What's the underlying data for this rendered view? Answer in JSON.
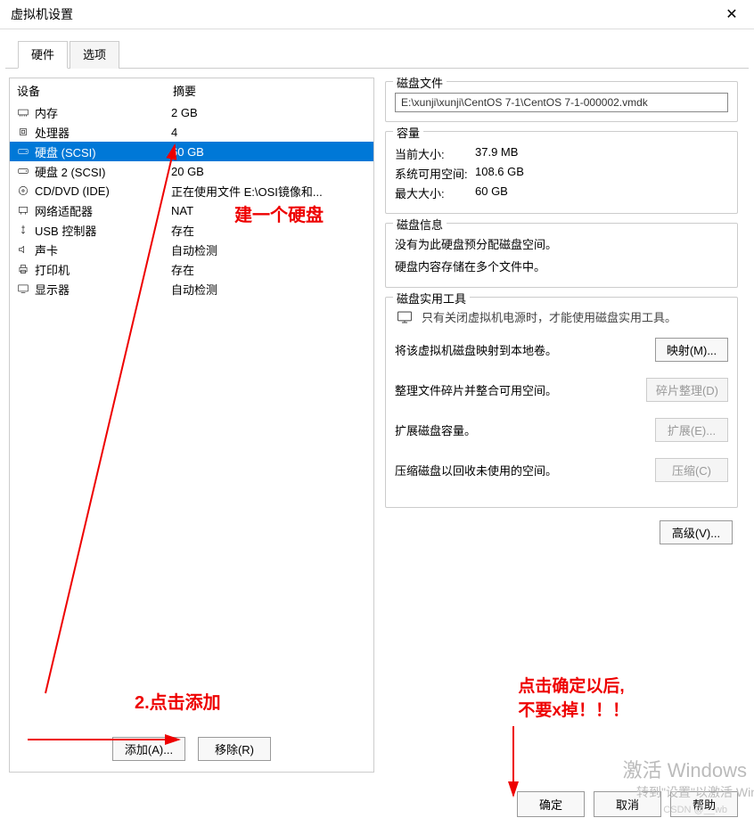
{
  "window": {
    "title": "虚拟机设置"
  },
  "tabs": {
    "hardware": "硬件",
    "options": "选项"
  },
  "dev_header": {
    "col1": "设备",
    "col2": "摘要"
  },
  "devices": [
    {
      "icon": "memory-icon",
      "name": "内存",
      "summary": "2 GB"
    },
    {
      "icon": "cpu-icon",
      "name": "处理器",
      "summary": "4"
    },
    {
      "icon": "disk-icon",
      "name": "硬盘 (SCSI)",
      "summary": "60 GB"
    },
    {
      "icon": "disk-icon",
      "name": "硬盘 2 (SCSI)",
      "summary": "20 GB"
    },
    {
      "icon": "cd-icon",
      "name": "CD/DVD (IDE)",
      "summary": "正在使用文件 E:\\OSI镜像和..."
    },
    {
      "icon": "network-icon",
      "name": "网络适配器",
      "summary": "NAT"
    },
    {
      "icon": "usb-icon",
      "name": "USB 控制器",
      "summary": "存在"
    },
    {
      "icon": "sound-icon",
      "name": "声卡",
      "summary": "自动检测"
    },
    {
      "icon": "printer-icon",
      "name": "打印机",
      "summary": "存在"
    },
    {
      "icon": "display-icon",
      "name": "显示器",
      "summary": "自动检测"
    }
  ],
  "selected_index": 2,
  "buttons": {
    "add": "添加(A)...",
    "remove": "移除(R)",
    "ok": "确定",
    "cancel": "取消",
    "help": "帮助",
    "advanced": "高级(V)..."
  },
  "groups": {
    "diskfile": {
      "title": "磁盘文件",
      "path": "E:\\xunji\\xunji\\CentOS 7-1\\CentOS 7-1-000002.vmdk"
    },
    "capacity": {
      "title": "容量",
      "current_label": "当前大小:",
      "current_val": "37.9 MB",
      "avail_label": "系统可用空间:",
      "avail_val": "108.6 GB",
      "max_label": "最大大小:",
      "max_val": "60 GB"
    },
    "diskinfo": {
      "title": "磁盘信息",
      "line1": "没有为此硬盘预分配磁盘空间。",
      "line2": "硬盘内容存储在多个文件中。"
    },
    "utility": {
      "title": "磁盘实用工具",
      "hint": "只有关闭虚拟机电源时，才能使用磁盘实用工具。",
      "rows": [
        {
          "text": "将该虚拟机磁盘映射到本地卷。",
          "btn": "映射(M)...",
          "disabled": false
        },
        {
          "text": "整理文件碎片并整合可用空间。",
          "btn": "碎片整理(D)",
          "disabled": true
        },
        {
          "text": "扩展磁盘容量。",
          "btn": "扩展(E)...",
          "disabled": true
        },
        {
          "text": "压缩磁盘以回收未使用的空间。",
          "btn": "压缩(C)",
          "disabled": true
        }
      ]
    }
  },
  "annotations": {
    "a1": "建一个硬盘",
    "a2": "2.点击添加",
    "a3_l1": "点击确定以后,",
    "a3_l2": "不要x掉！！！"
  },
  "watermark": {
    "l1": "激活 Windows",
    "l2": "转到\"设置\"以激活 Win",
    "csdn": "CSDN @__wb"
  }
}
